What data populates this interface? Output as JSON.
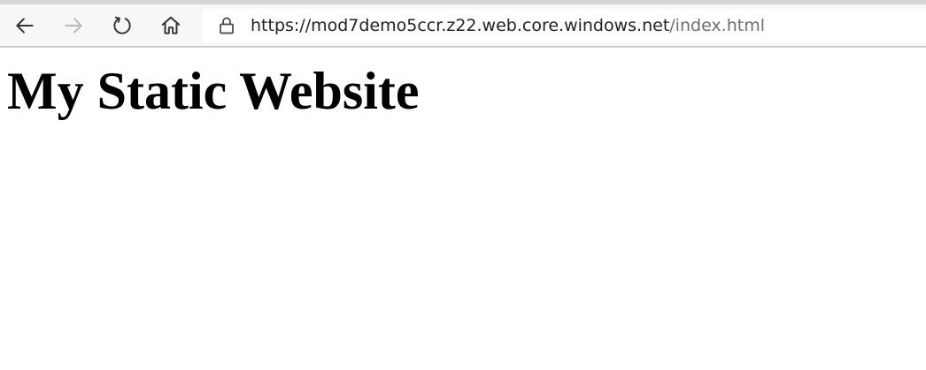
{
  "browser": {
    "url_domain": "https://mod7demo5ccr.z22.web.core.windows.net",
    "url_path": "/index.html",
    "icons": {
      "back": "back-arrow-icon",
      "forward": "forward-arrow-icon",
      "refresh": "refresh-icon",
      "home": "home-icon",
      "lock": "lock-icon"
    }
  },
  "page": {
    "heading": "My Static Website"
  },
  "colors": {
    "url_domain": "#222222",
    "url_path": "#6f6f6f",
    "forward_disabled": "#b8b8b8",
    "icon": "#333333"
  }
}
